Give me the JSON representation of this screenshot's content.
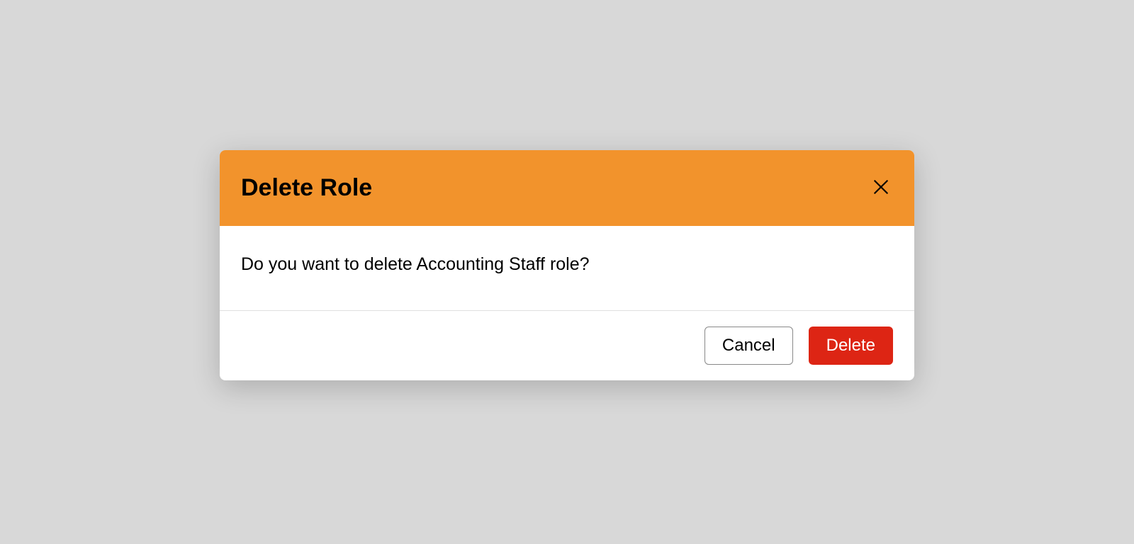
{
  "modal": {
    "title": "Delete Role",
    "message": "Do you want to delete Accounting Staff role?",
    "cancel_label": "Cancel",
    "delete_label": "Delete"
  },
  "colors": {
    "header_bg": "#f2932c",
    "delete_bg": "#dd2514",
    "page_bg": "#d8d8d8"
  }
}
